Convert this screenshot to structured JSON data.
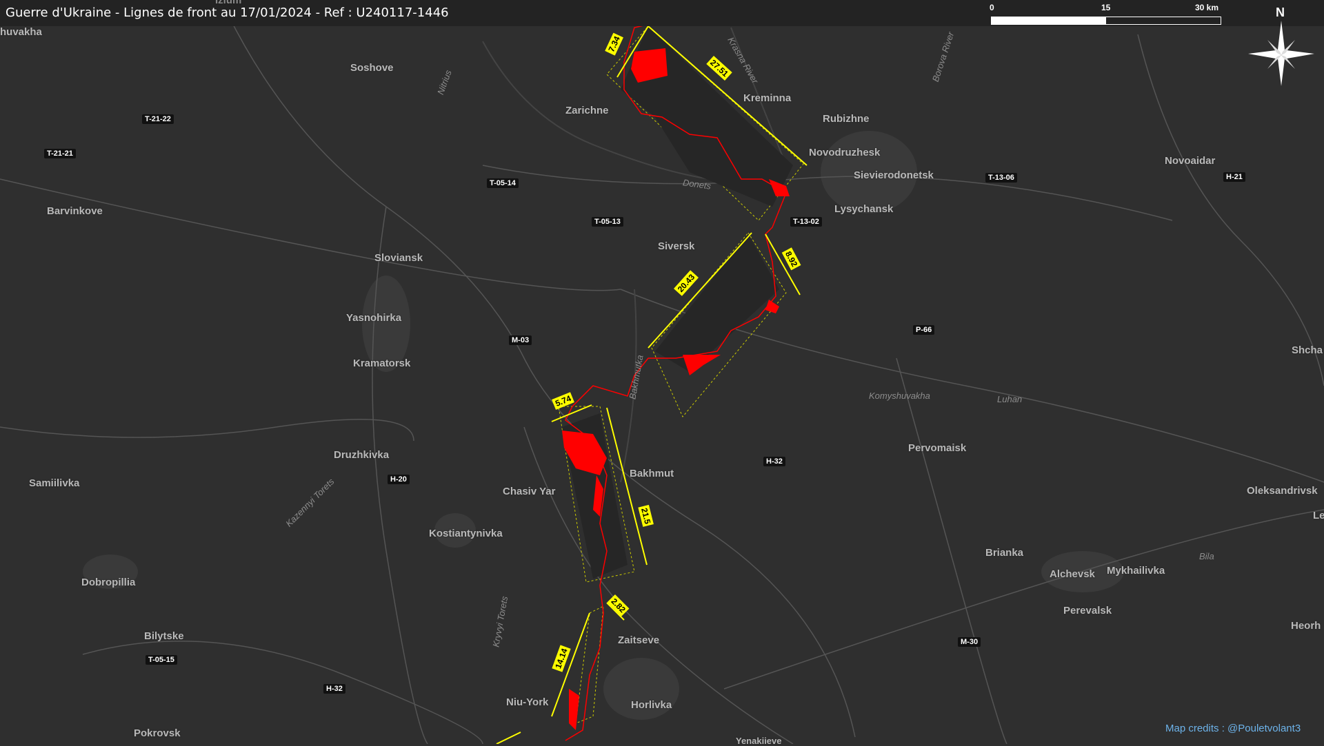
{
  "title": "Guerre d'Ukraine - Lignes de front au 17/01/2024 - Ref : U240117-1446",
  "scale": {
    "labels": [
      "0",
      "15",
      "30 km"
    ]
  },
  "north_label": "N",
  "credits": "Map credits : @Pouletvolant3",
  "colors": {
    "background": "#2f2f2f",
    "front_line": "#ff0000",
    "measure": "#ffff00",
    "credits": "#6db3ea"
  },
  "cities": {
    "shuvakha": "huvakha",
    "izium": "Izium",
    "soshove": "Soshove",
    "zarichne": "Zarichne",
    "kreminna": "Kreminna",
    "rubizhne": "Rubizhne",
    "novodruzhesk": "Novodruzhesk",
    "sievierodonetsk": "Sievierodonetsk",
    "lysychansk": "Lysychansk",
    "novoaidar": "Novoaidar",
    "barvinkove": "Barvinkove",
    "sloviansk": "Sloviansk",
    "siversk": "Siversk",
    "yasnohirka": "Yasnohirka",
    "kramatorsk": "Kramatorsk",
    "druzhkivka": "Druzhkivka",
    "samiilivka": "Samiilivka",
    "chasiv_yar": "Chasiv Yar",
    "bakhmut": "Bakhmut",
    "kostiantynivka": "Kostiantynivka",
    "pervomaisk": "Pervomaisk",
    "oleksandrivsk": "Oleksandrivsk",
    "brianka": "Brianka",
    "alchevsk": "Alchevsk",
    "mykhailivka": "Mykhailivka",
    "perevalsk": "Perevalsk",
    "dobropillia": "Dobropillia",
    "bilytske": "Bilytske",
    "zaitseve": "Zaitseve",
    "niu_york": "Niu-York",
    "horlivka": "Horlivka",
    "pokrovsk": "Pokrovsk",
    "yenakiieve": "Yenakiieve",
    "shcha": "Shcha",
    "heorh": "Heorh",
    "le": "Le"
  },
  "roads": {
    "t2122": "T-21-22",
    "t2121": "T-21-21",
    "t0514": "T-05-14",
    "t0513": "T-05-13",
    "t1302": "T-13-02",
    "t1306": "T-13-06",
    "h21": "H-21",
    "p66": "P-66",
    "m03": "M-03",
    "h32a": "H-32",
    "h20": "H-20",
    "m30": "M-30",
    "t0515": "T-05-15",
    "h32b": "H-32"
  },
  "rivers": {
    "krasna": "Krasna River",
    "borova": "Borova River",
    "nitrius": "Nitrius",
    "donets": "Donets",
    "bakhmutka": "Bakhmutka",
    "komyshuvakha": "Komyshuvakha",
    "luhan": "Luhan",
    "kazennyi_torets": "Kazennyi Torets",
    "kryvyi_torets": "Kryvyi Torets",
    "bila": "Bila"
  },
  "measures": {
    "m1": "7.34",
    "m2": "27.51",
    "m3": "8.92",
    "m4": "20.43",
    "m5": "5.74",
    "m6": "21.5",
    "m7": "2.82",
    "m8": "14.14"
  }
}
